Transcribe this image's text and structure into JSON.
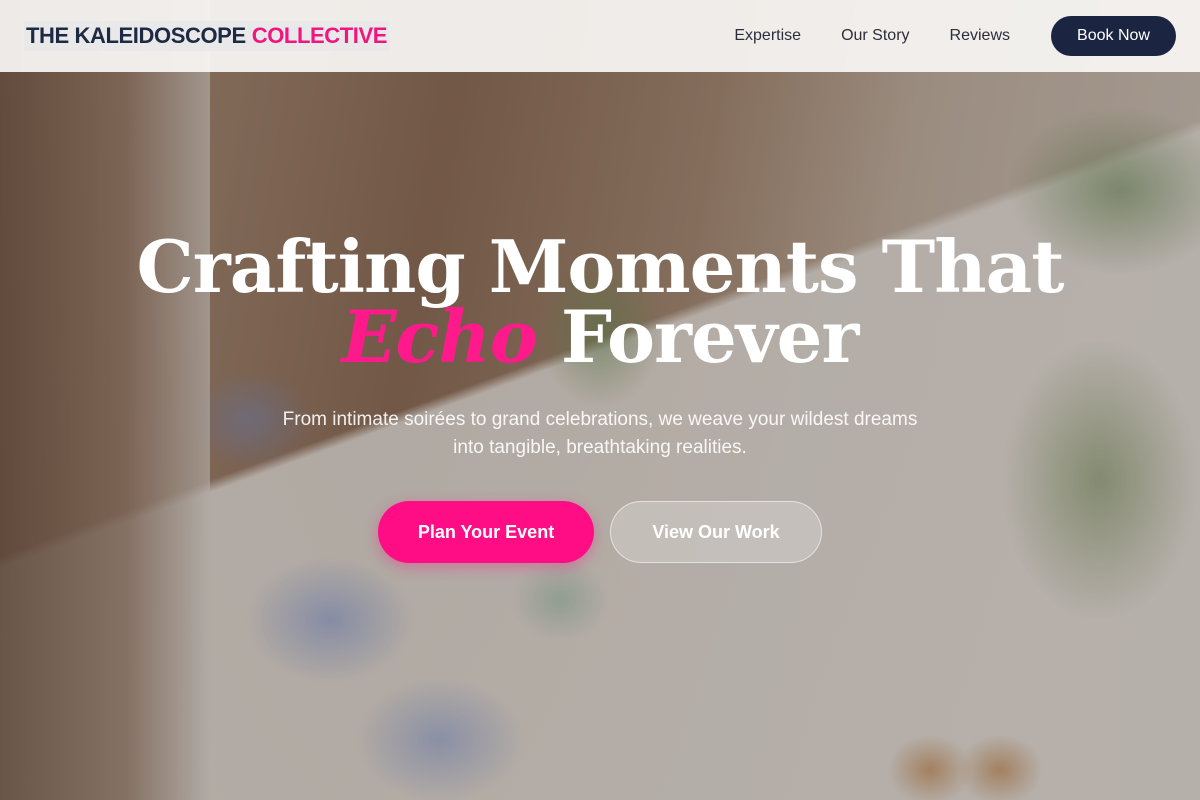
{
  "brand": {
    "part1": "THE KALEIDOSCOPE",
    "part2": "COLLECTIVE"
  },
  "nav": {
    "links": [
      "Expertise",
      "Our Story",
      "Reviews"
    ],
    "cta": "Book Now"
  },
  "hero": {
    "headline_line1": "Crafting Moments That",
    "headline_accent": "Echo",
    "headline_line2_rest": "Forever",
    "subtitle": "From intimate soirées to grand celebrations, we weave your wildest dreams into tangible, breathtaking realities.",
    "primary_cta": "Plan Your Event",
    "secondary_cta": "View Our Work"
  },
  "colors": {
    "accent": "#ff0d85",
    "navy": "#1b2541"
  }
}
